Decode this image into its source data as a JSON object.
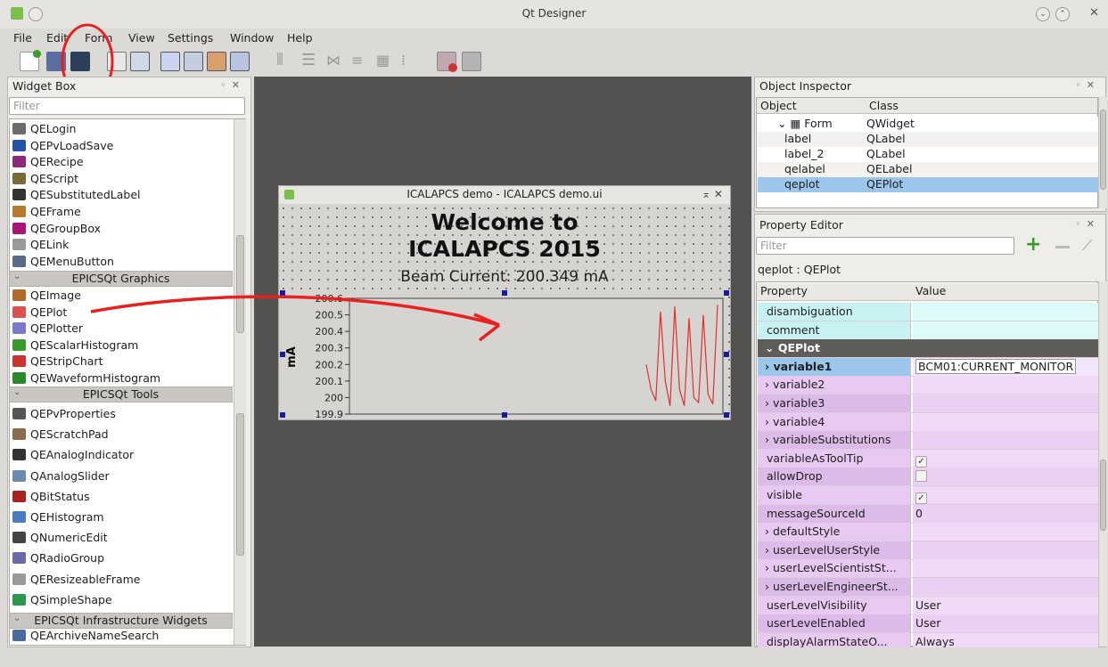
{
  "window": {
    "title": "Qt Designer"
  },
  "menu": [
    "File",
    "Edit",
    "Form",
    "View",
    "Settings",
    "Window",
    "Help"
  ],
  "toolbar_icons": [
    "new-form-icon",
    "open-icon",
    "save-icon",
    "copy-icon",
    "paste-icon",
    "edit-widgets-icon",
    "edit-signals-icon",
    "edit-buddies-icon",
    "edit-tab-order-icon",
    "layout-horizontal-icon",
    "layout-vertical-icon",
    "layout-splitter-h-icon",
    "layout-splitter-v-icon",
    "layout-grid-icon",
    "layout-form-icon",
    "break-layout-icon",
    "adjust-size-icon"
  ],
  "widget_box": {
    "title": "Widget Box",
    "filter_placeholder": "Filter",
    "items_top": [
      {
        "label": "QELogin",
        "icon": "login-icon",
        "color": "#6b6b6b"
      },
      {
        "label": "QEPvLoadSave",
        "icon": "pvloadsave-icon",
        "color": "#2255aa"
      },
      {
        "label": "QERecipe",
        "icon": "recipe-icon",
        "color": "#8a2a7a"
      },
      {
        "label": "QEScript",
        "icon": "script-icon",
        "color": "#7a6a3a"
      },
      {
        "label": "QESubstitutedLabel",
        "icon": "substituted-label-icon",
        "color": "#333333"
      },
      {
        "label": "QEFrame",
        "icon": "frame-icon",
        "color": "#b7792a"
      },
      {
        "label": "QEGroupBox",
        "icon": "groupbox-icon",
        "color": "#a8137a"
      },
      {
        "label": "QELink",
        "icon": "link-icon",
        "color": "#9a9a9a"
      },
      {
        "label": "QEMenuButton",
        "icon": "menubutton-icon",
        "color": "#5a6a8a"
      }
    ],
    "cat_graphics": "EPICSQt Graphics",
    "items_graphics": [
      {
        "label": "QEImage",
        "icon": "image-icon",
        "color": "#b06a2a"
      },
      {
        "label": "QEPlot",
        "icon": "plot-icon",
        "color": "#d9534f"
      },
      {
        "label": "QEPlotter",
        "icon": "plotter-icon",
        "color": "#7a7acc"
      },
      {
        "label": "QEScalarHistogram",
        "icon": "scalar-histogram-icon",
        "color": "#3a9a2a"
      },
      {
        "label": "QEStripChart",
        "icon": "stripchart-icon",
        "color": "#cc3333"
      },
      {
        "label": "QEWaveformHistogram",
        "icon": "waveform-histogram-icon",
        "color": "#2a8a2a"
      }
    ],
    "cat_tools": "EPICSQt Tools",
    "items_tools": [
      {
        "label": "QEPvProperties",
        "icon": "pvproperties-icon",
        "color": "#555555"
      },
      {
        "label": "QEScratchPad",
        "icon": "scratchpad-icon",
        "color": "#8a6a4a"
      },
      {
        "label": "QEAnalogIndicator",
        "icon": "analog-indicator-icon",
        "color": "#333333"
      },
      {
        "label": "QAnalogSlider",
        "icon": "analog-slider-icon",
        "color": "#6a8ab0"
      },
      {
        "label": "QBitStatus",
        "icon": "bitstatus-icon",
        "color": "#aa2222"
      },
      {
        "label": "QEHistogram",
        "icon": "histogram-icon",
        "color": "#4a7ac0"
      },
      {
        "label": "QNumericEdit",
        "icon": "numeric-edit-icon",
        "color": "#444444"
      },
      {
        "label": "QRadioGroup",
        "icon": "radio-group-icon",
        "color": "#6a6aaa"
      },
      {
        "label": "QEResizeableFrame",
        "icon": "resizeable-frame-icon",
        "color": "#999999"
      },
      {
        "label": "QSimpleShape",
        "icon": "simple-shape-icon",
        "color": "#2a9a4a"
      }
    ],
    "cat_infra": "EPICSQt Infrastructure Widgets",
    "items_infra": [
      {
        "label": "QEArchiveNameSearch",
        "icon": "archive-search-icon",
        "color": "#4a6aa0"
      }
    ]
  },
  "form": {
    "window_title": "ICALAPCS demo - ICALAPCS demo.ui",
    "welcome_line1": "Welcome to",
    "welcome_line2": "ICALAPCS 2015",
    "beam_text": "Beam Current: 200.349 mA",
    "plot_ylabel": "mA",
    "plot_ticks": [
      "200.6",
      "200.5",
      "200.4",
      "200.3",
      "200.2",
      "200.1",
      "200",
      "199.9"
    ]
  },
  "chart_data": {
    "type": "line",
    "ylabel": "mA",
    "ylim": [
      199.9,
      200.6
    ],
    "yticks": [
      199.9,
      200,
      200.1,
      200.2,
      200.3,
      200.4,
      200.5,
      200.6
    ],
    "series": [
      {
        "color": "#e03030",
        "values": [
          200.2,
          200.05,
          199.98,
          200.52,
          200.1,
          199.95,
          200.55,
          200.05,
          199.95,
          200.48,
          200.0,
          199.97,
          200.5,
          200.02,
          199.96,
          200.56
        ]
      }
    ]
  },
  "object_inspector": {
    "title": "Object Inspector",
    "col_object": "Object",
    "col_class": "Class",
    "rows": [
      {
        "object": "Form",
        "class": "QWidget"
      },
      {
        "object": "label",
        "class": "QLabel"
      },
      {
        "object": "label_2",
        "class": "QLabel"
      },
      {
        "object": "qelabel",
        "class": "QELabel"
      },
      {
        "object": "qeplot",
        "class": "QEPlot"
      }
    ]
  },
  "property_editor": {
    "title": "Property Editor",
    "filter_placeholder": "Filter",
    "object_label": "qeplot : QEPlot",
    "col_property": "Property",
    "col_value": "Value",
    "section": "QEPlot",
    "rows_top": [
      {
        "name": "disambiguation",
        "value": ""
      },
      {
        "name": "comment",
        "value": ""
      }
    ],
    "rows": [
      {
        "name": "variable1",
        "value": "BCM01:CURRENT_MONITOR",
        "expand": true,
        "bold": true,
        "selected": true
      },
      {
        "name": "variable2",
        "value": "",
        "expand": true
      },
      {
        "name": "variable3",
        "value": "",
        "expand": true
      },
      {
        "name": "variable4",
        "value": "",
        "expand": true
      },
      {
        "name": "variableSubstitutions",
        "value": "",
        "expand": true
      },
      {
        "name": "variableAsToolTip",
        "value": "",
        "check": true
      },
      {
        "name": "allowDrop",
        "value": "",
        "check": false
      },
      {
        "name": "visible",
        "value": "",
        "check": true
      },
      {
        "name": "messageSourceId",
        "value": "0"
      },
      {
        "name": "defaultStyle",
        "value": "",
        "expand": true
      },
      {
        "name": "userLevelUserStyle",
        "value": "",
        "expand": true
      },
      {
        "name": "userLevelScientistSt...",
        "value": "",
        "expand": true
      },
      {
        "name": "userLevelEngineerSt...",
        "value": "",
        "expand": true
      },
      {
        "name": "userLevelVisibility",
        "value": "User"
      },
      {
        "name": "userLevelEnabled",
        "value": "User"
      },
      {
        "name": "displayAlarmStateO...",
        "value": "Always"
      }
    ]
  }
}
